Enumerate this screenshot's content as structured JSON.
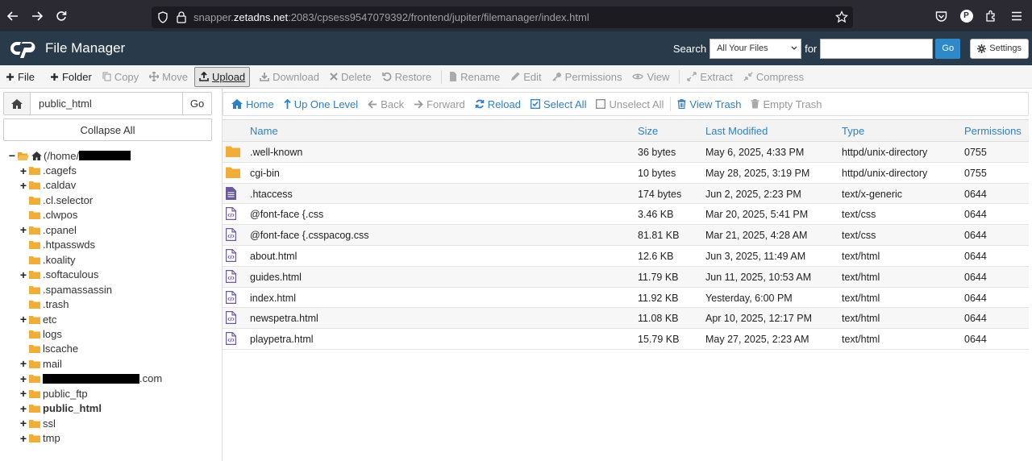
{
  "browser": {
    "url_prefix": "snapper.",
    "url_host": "zetadns.net",
    "url_rest": ":2083/cpsess9547079392/frontend/jupiter/filemanager/index.html",
    "profile_letter": "P"
  },
  "header": {
    "title": "File Manager",
    "search_label": "Search",
    "search_scope": "All Your Files",
    "for_label": "for",
    "go_label": "Go",
    "settings_label": "Settings"
  },
  "toolbar": {
    "file": "File",
    "folder": "Folder",
    "copy": "Copy",
    "move": "Move",
    "upload": "Upload",
    "download": "Download",
    "delete": "Delete",
    "restore": "Restore",
    "rename": "Rename",
    "edit": "Edit",
    "permissions": "Permissions",
    "view": "View",
    "extract": "Extract",
    "compress": "Compress"
  },
  "left": {
    "path_value": "public_html",
    "go_label": "Go",
    "collapse_label": "Collapse All",
    "root_label": "(/home/",
    "tree": [
      {
        "label": ".cagefs",
        "expandable": true
      },
      {
        "label": ".caldav",
        "expandable": true
      },
      {
        "label": ".cl.selector",
        "expandable": false
      },
      {
        "label": ".clwpos",
        "expandable": false
      },
      {
        "label": ".cpanel",
        "expandable": true
      },
      {
        "label": ".htpasswds",
        "expandable": false
      },
      {
        "label": ".koality",
        "expandable": false
      },
      {
        "label": ".softaculous",
        "expandable": true
      },
      {
        "label": ".spamassassin",
        "expandable": false
      },
      {
        "label": ".trash",
        "expandable": false
      },
      {
        "label": "etc",
        "expandable": true
      },
      {
        "label": "logs",
        "expandable": false
      },
      {
        "label": "lscache",
        "expandable": false
      },
      {
        "label": "mail",
        "expandable": true
      },
      {
        "label": ".com",
        "expandable": true
      },
      {
        "label": "public_ftp",
        "expandable": true
      },
      {
        "label": "public_html",
        "expandable": true
      },
      {
        "label": "ssl",
        "expandable": true
      },
      {
        "label": "tmp",
        "expandable": true
      }
    ]
  },
  "nav": {
    "home": "Home",
    "up": "Up One Level",
    "back": "Back",
    "forward": "Forward",
    "reload": "Reload",
    "select_all": "Select All",
    "unselect_all": "Unselect All",
    "view_trash": "View Trash",
    "empty_trash": "Empty Trash"
  },
  "table": {
    "headers": {
      "name": "Name",
      "size": "Size",
      "modified": "Last Modified",
      "type": "Type",
      "perms": "Permissions"
    },
    "rows": [
      {
        "icon": "folder",
        "name": ".well-known",
        "size": "36 bytes",
        "modified": "May 6, 2025, 4:33 PM",
        "type": "httpd/unix-directory",
        "perms": "0755"
      },
      {
        "icon": "folder",
        "name": "cgi-bin",
        "size": "10 bytes",
        "modified": "May 28, 2025, 3:19 PM",
        "type": "httpd/unix-directory",
        "perms": "0755"
      },
      {
        "icon": "text",
        "name": ".htaccess",
        "size": "174 bytes",
        "modified": "Jun 2, 2025, 2:23 PM",
        "type": "text/x-generic",
        "perms": "0644"
      },
      {
        "icon": "code",
        "name": "@font-face {.css",
        "size": "3.46 KB",
        "modified": "Mar 20, 2025, 5:41 PM",
        "type": "text/css",
        "perms": "0644"
      },
      {
        "icon": "code",
        "name": "@font-face {.csspacog.css",
        "size": "81.81 KB",
        "modified": "Mar 21, 2025, 4:28 AM",
        "type": "text/css",
        "perms": "0644"
      },
      {
        "icon": "code",
        "name": "about.html",
        "size": "12.6 KB",
        "modified": "Jun 3, 2025, 11:49 AM",
        "type": "text/html",
        "perms": "0644"
      },
      {
        "icon": "code",
        "name": "guides.html",
        "size": "11.79 KB",
        "modified": "Jun 11, 2025, 10:53 AM",
        "type": "text/html",
        "perms": "0644"
      },
      {
        "icon": "code",
        "name": "index.html",
        "size": "11.92 KB",
        "modified": "Yesterday, 6:00 PM",
        "type": "text/html",
        "perms": "0644"
      },
      {
        "icon": "code",
        "name": "newspetra.html",
        "size": "11.08 KB",
        "modified": "Apr 10, 2025, 12:17 PM",
        "type": "text/html",
        "perms": "0644"
      },
      {
        "icon": "code",
        "name": "playpetra.html",
        "size": "15.79 KB",
        "modified": "May 27, 2025, 2:23 AM",
        "type": "text/html",
        "perms": "0644"
      }
    ]
  },
  "colors": {
    "link": "#2f80c2",
    "header_bg": "#293a4a",
    "folder": "#f0ad38",
    "file_icon": "#6a5a9c"
  }
}
